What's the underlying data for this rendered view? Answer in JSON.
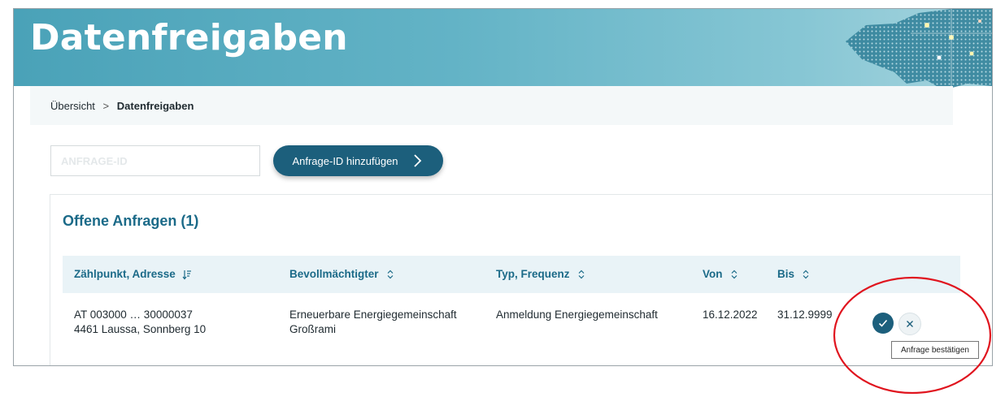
{
  "banner": {
    "title": "Datenfreigaben"
  },
  "breadcrumb": {
    "items": [
      "Übersicht",
      "Datenfreigaben"
    ],
    "separator": ">"
  },
  "request_form": {
    "input_placeholder": "ANFRAGE-ID",
    "input_value": "",
    "add_button_label": "Anfrage-ID hinzufügen"
  },
  "section": {
    "title": "Offene Anfragen (1)"
  },
  "table": {
    "columns": [
      "Zählpunkt, Adresse",
      "Bevollmächtigter",
      "Typ, Frequenz",
      "Von",
      "Bis"
    ],
    "rows": [
      {
        "zaehlpunkt": "AT 003000 … 30000037",
        "adresse": "4461 Laussa, Sonnberg 10",
        "bevollmaechtigter_1": "Erneuerbare Energiegemeinschaft",
        "bevollmaechtigter_2": "Großrami",
        "typ": "Anmeldung Energiegemeinschaft",
        "von": "16.12.2022",
        "bis": "31.12.9999"
      }
    ]
  },
  "actions": {
    "tooltip": "Anfrage bestätigen"
  },
  "colors": {
    "banner": "#5aaec2",
    "primary": "#1c5f7c",
    "heading": "#1b6a88",
    "table_header_bg": "#e9f3f7",
    "highlight": "#e0141e"
  },
  "icons": {
    "sort_active": "sort-descending-icon",
    "sort": "sort-icon",
    "next": "chevron-right-icon",
    "confirm": "checkmark-icon",
    "reject": "close-icon"
  }
}
